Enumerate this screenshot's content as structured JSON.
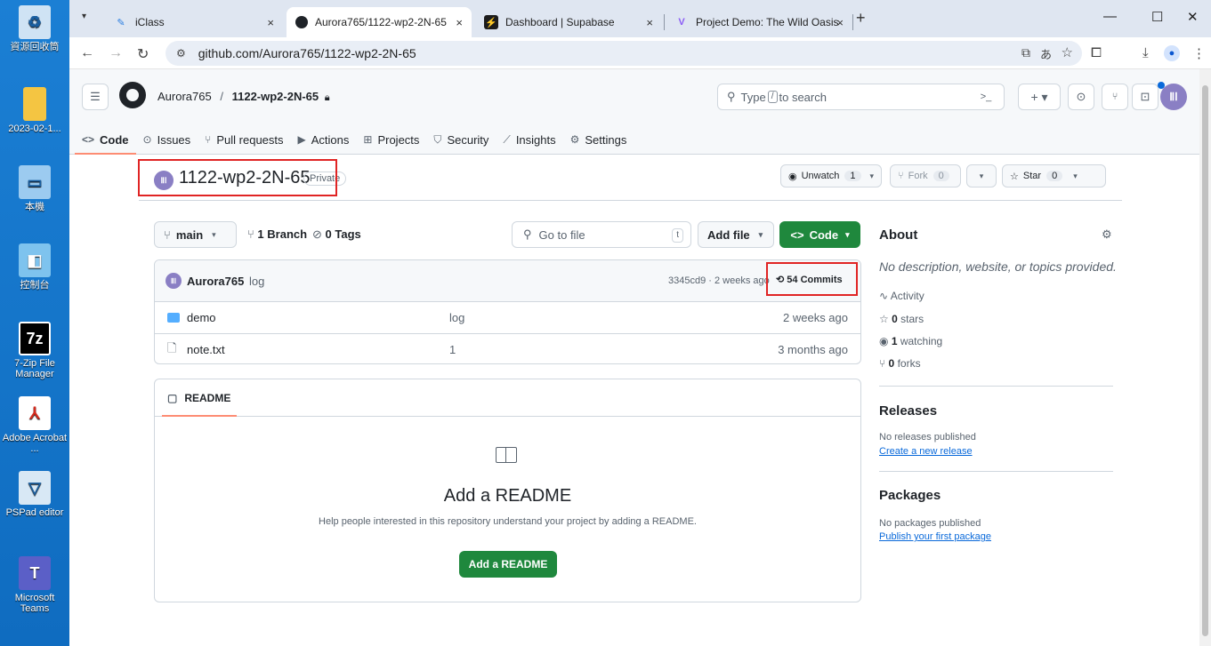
{
  "desktop": {
    "icons": [
      {
        "label": "資源回收筒"
      },
      {
        "label": "2023-02-1..."
      },
      {
        "label": "本機"
      },
      {
        "label": "控制台"
      },
      {
        "label": "7-Zip File Manager"
      },
      {
        "label": "Adobe Acrobat ..."
      },
      {
        "label": "PSPad editor"
      },
      {
        "label": "Microsoft Teams"
      }
    ]
  },
  "browser": {
    "tabs": [
      {
        "title": "iClass",
        "close": "×"
      },
      {
        "title": "Aurora765/1122-wp2-2N-65",
        "close": "×"
      },
      {
        "title": "Dashboard | Supabase",
        "close": "×"
      },
      {
        "title": "Project Demo: The Wild Oasis",
        "close": "×"
      }
    ],
    "new_tab": "+",
    "url": "github.com/Aurora765/1122-wp2-2N-65"
  },
  "github": {
    "breadcrumb_owner": "Aurora765",
    "breadcrumb_sep": "/",
    "breadcrumb_repo": "1122-wp2-2N-65",
    "search_prefix": "Type",
    "search_key": "/",
    "search_suffix": "to search",
    "search_term": ">_",
    "nav": [
      {
        "label": "Code"
      },
      {
        "label": "Issues"
      },
      {
        "label": "Pull requests"
      },
      {
        "label": "Actions"
      },
      {
        "label": "Projects"
      },
      {
        "label": "Security"
      },
      {
        "label": "Insights"
      },
      {
        "label": "Settings"
      }
    ],
    "repo": {
      "name": "1122-wp2-2N-65",
      "visibility": "Private",
      "unwatch_label": "Unwatch",
      "unwatch_count": "1",
      "fork_label": "Fork",
      "fork_count": "0",
      "star_label": "Star",
      "star_count": "0"
    },
    "branch": {
      "current": "main",
      "branches": "1 Branch",
      "tags": "0 Tags"
    },
    "goto_placeholder": "Go to file",
    "goto_key": "t",
    "add_file": "Add file",
    "code_button": "Code",
    "commit": {
      "author": "Aurora765",
      "message": "log",
      "meta": "3345cd9 · 2 weeks ago",
      "count": "54 Commits"
    },
    "files": [
      {
        "name": "demo",
        "type": "folder",
        "message": "log",
        "time": "2 weeks ago"
      },
      {
        "name": "note.txt",
        "type": "file",
        "message": "1",
        "time": "3 months ago"
      }
    ],
    "readme": {
      "tab": "README",
      "title": "Add a README",
      "description": "Help people interested in this repository understand your project by adding a README.",
      "button": "Add a README"
    },
    "about": {
      "title": "About",
      "description": "No description, website, or topics provided.",
      "activity": "Activity",
      "stars": "0",
      "stars_label": "stars",
      "watching": "1",
      "watching_label": "watching",
      "forks": "0",
      "forks_label": "forks",
      "releases_title": "Releases",
      "releases_text": "No releases published",
      "releases_link": "Create a new release",
      "packages_title": "Packages",
      "packages_text": "No packages published",
      "packages_link": "Publish your first package"
    }
  },
  "colors": {
    "accent_green": "#1f883d",
    "annotation_red": "#e02424",
    "nav_underline": "#fd8c73",
    "link_blue": "#0969da"
  }
}
